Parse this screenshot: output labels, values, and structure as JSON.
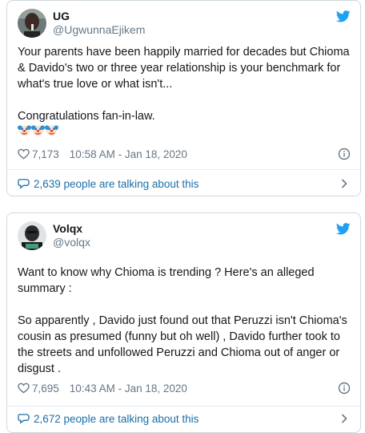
{
  "tweets": [
    {
      "display_name": "UG",
      "handle": "@UgwunnaEjikem",
      "text": "Your parents have been happily married for decades but Chioma & Davido's two or three year relationship is your benchmark for what's true love or what isn't...\n\nCongratulations fan-in-law.",
      "emojis": [
        "clown-face-emoji",
        "clown-face-emoji",
        "clown-face-emoji"
      ],
      "likes": "7,173",
      "timestamp": "10:58 AM - Jan 18, 2020",
      "talking": "2,639 people are talking about this"
    },
    {
      "display_name": "Volqx",
      "handle": "@volqx",
      "text": "Want to know why Chioma is trending ? Here's an alleged summary :\n\nSo apparently , Davido just found out that Peruzzi isn't Chioma's cousin as presumed (funny but oh well) , Davido further took to the streets and unfollowed Peruzzi and Chioma out of anger or disgust .",
      "likes": "7,695",
      "timestamp": "10:43 AM - Jan 18, 2020",
      "talking": "2,672 people are talking about this"
    }
  ],
  "colors": {
    "brand": "#1da1f2",
    "link": "#1b6fa8",
    "muted": "#657786"
  },
  "icons": [
    "twitter-bird-icon",
    "heart-icon",
    "info-icon",
    "comment-icon",
    "chevron-right-icon"
  ]
}
